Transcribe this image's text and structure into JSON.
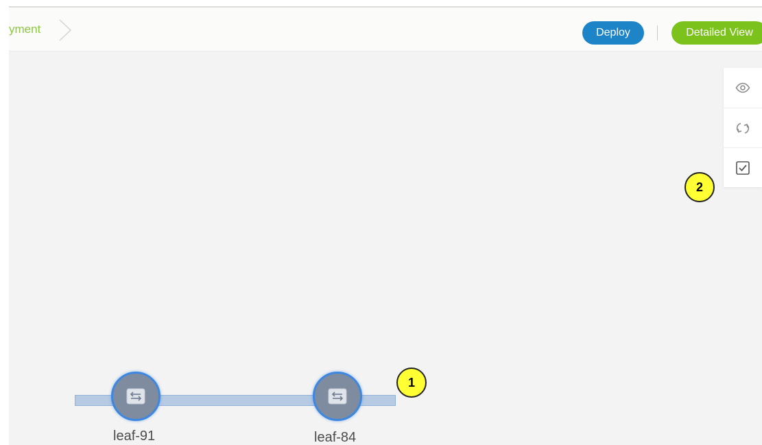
{
  "breadcrumb": {
    "partial_label": "yment"
  },
  "header": {
    "deploy_label": "Deploy",
    "detailed_view_label": "Detailed View"
  },
  "toolbar": {
    "icons": [
      "eye-icon",
      "refresh-icon",
      "checkbox-icon"
    ]
  },
  "callouts": {
    "one": "1",
    "two": "2"
  },
  "topology": {
    "nodes": [
      {
        "label": "leaf-91"
      },
      {
        "label": "leaf-84"
      }
    ]
  },
  "colors": {
    "deploy_button": "#1e84c8",
    "detailed_view_button": "#7cc21d",
    "breadcrumb_text": "#8cc63f",
    "callout": "#ffff33",
    "node_fill": "#7f8ca0",
    "node_ring": "#3d87e0"
  }
}
